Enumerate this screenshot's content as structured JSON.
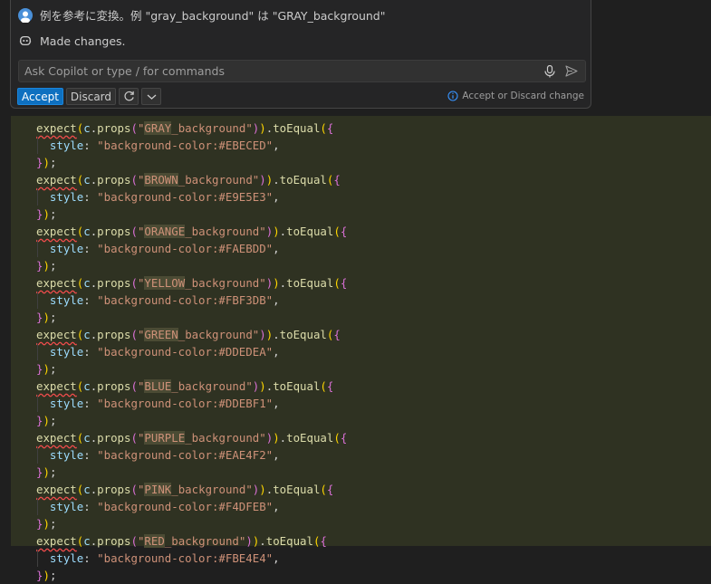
{
  "chat": {
    "request_text": "例を参考に変換。例 \"gray_background\" は \"GRAY_background\"",
    "response_text": "Made changes.",
    "input_placeholder": "Ask Copilot or type / for commands",
    "accept_label": "Accept",
    "discard_label": "Discard",
    "hint_text": "Accept or Discard change"
  },
  "code": {
    "fn_name": "expect",
    "var_name": "c",
    "method_props": "props",
    "method_to_equal": "toEqual",
    "style_key": "style",
    "blocks": [
      {
        "key": "GRAY",
        "suffix": "_background",
        "value": "\"background-color:#EBECED\""
      },
      {
        "key": "BROWN",
        "suffix": "_background",
        "value": "\"background-color:#E9E5E3\""
      },
      {
        "key": "ORANGE",
        "suffix": "_background",
        "value": "\"background-color:#FAEBDD\""
      },
      {
        "key": "YELLOW",
        "suffix": "_background",
        "value": "\"background-color:#FBF3DB\""
      },
      {
        "key": "GREEN",
        "suffix": "_background",
        "value": "\"background-color:#DDEDEA\""
      },
      {
        "key": "BLUE",
        "suffix": "_background",
        "value": "\"background-color:#DDEBF1\""
      },
      {
        "key": "PURPLE",
        "suffix": "_background",
        "value": "\"background-color:#EAE4F2\""
      },
      {
        "key": "PINK",
        "suffix": "_background",
        "value": "\"background-color:#F4DFEB\""
      },
      {
        "key": "RED",
        "suffix": "_background",
        "value": "\"background-color:#FBE4E4\""
      }
    ]
  },
  "colors": {
    "accent_button": "#0e70c0",
    "inserted_background": "#2f3222",
    "editor_background": "#1f1f1f"
  }
}
